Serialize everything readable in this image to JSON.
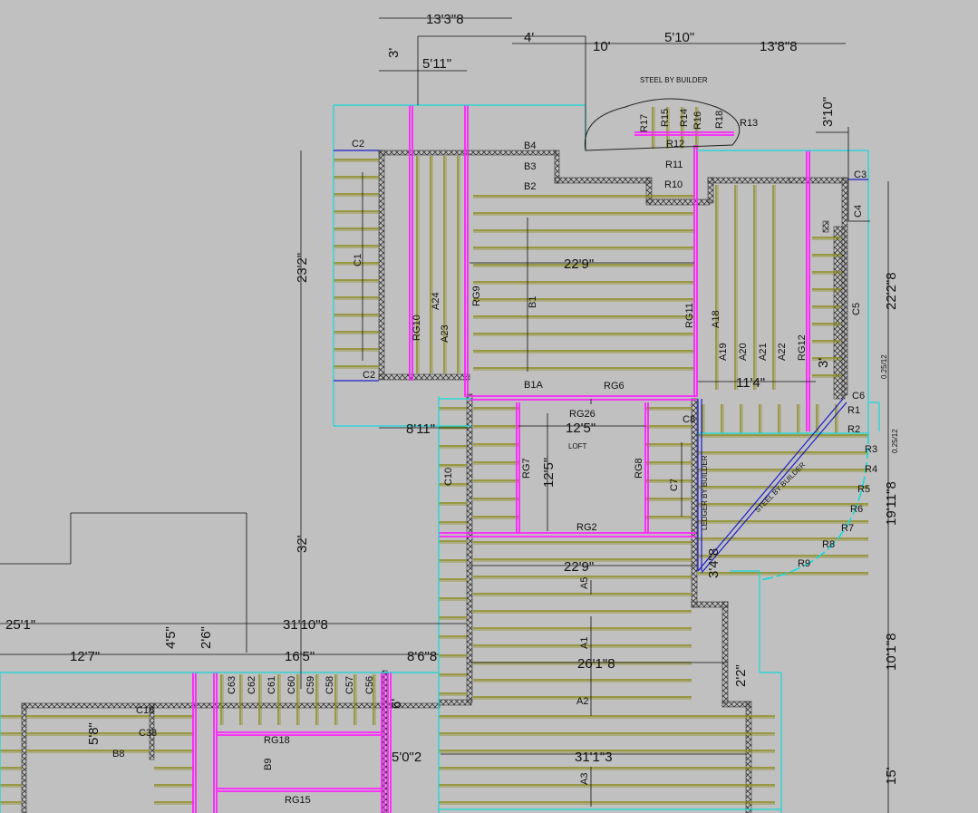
{
  "colors": {
    "background": "#c0c0c0",
    "joist": "#8a8a1a",
    "girder": "#ff22ff",
    "outline": "#14d8d8",
    "beam": "#1c1cc8",
    "dim": "#111111",
    "hatch": "#444444"
  },
  "dims": {
    "d_13_3_8": "13'3\"8",
    "d_4": "4'",
    "d_10": "10'",
    "d_5_10": "5'10\"",
    "d_13_8_8": "13'8\"8",
    "d_3": "3'",
    "d_5_11": "5'11\"",
    "d_3_10": "3'10\"",
    "d_23_2": "23'2\"",
    "d_22_9_top": "22'9\"",
    "d_22_2_8": "22'2\"8",
    "d_11_4": "11'4\"",
    "d_3b": "3'",
    "d_8_11": "8'11\"",
    "d_12_5_h": "12'5\"",
    "d_12_5_v": "12'5\"",
    "d_19_11_8": "19'11\"8",
    "d_32": "32'",
    "d_22_9_mid": "22'9\"",
    "d_3_4_8": "3'4\"8",
    "d_25_1": "25'1\"",
    "d_31_10_8": "31'10\"8",
    "d_4_5": "4'5\"",
    "d_2_6": "2'6\"",
    "d_12_7": "12'7\"",
    "d_16_5": "16'5\"",
    "d_8_6_8": "8'6\"8",
    "d_10_1_8": "10'1\"8",
    "d_26_1_8": "26'1\"8",
    "d_2_2": "2'2\"",
    "d_6": "6'",
    "d_5_0_2": "5'0\"2",
    "d_31_1_3": "31'1\"3",
    "d_5_8": "5'8\"",
    "d_15": "15'"
  },
  "slopes": {
    "s1": "0.25/12",
    "s2": "0.25/12"
  },
  "notes": {
    "steel_top": "STEEL BY BUILDER",
    "steel_diag": "STEEL BY BUILDER",
    "ledger": "LEDGER BY BUILDER",
    "loft": "LOFT"
  },
  "labels": {
    "B4": "B4",
    "B3": "B3",
    "B2": "B2",
    "B1": "B1",
    "B1A": "B1A",
    "C1": "C1",
    "C2a": "C2",
    "C2b": "C2",
    "C3": "C3",
    "C4": "C4",
    "C5": "C5",
    "C6": "C6",
    "C7": "C7",
    "C8": "C8",
    "C10": "C10",
    "A24": "A24",
    "A23": "A23",
    "A18": "A18",
    "A19": "A19",
    "A20": "A20",
    "A21": "A21",
    "A22": "A22",
    "RG9": "RG9",
    "RG10": "RG10",
    "RG11": "RG11",
    "RG12": "RG12",
    "RG6": "RG6",
    "RG26": "RG26",
    "RG7": "RG7",
    "RG8": "RG8",
    "RG2": "RG2",
    "R1": "R1",
    "R2": "R2",
    "R3": "R3",
    "R4": "R4",
    "R5": "R5",
    "R6": "R6",
    "R7": "R7",
    "R8": "R8",
    "R9": "R9",
    "R10": "R10",
    "R11": "R11",
    "R12": "R12",
    "R13": "R13",
    "R14": "R14",
    "R15": "R15",
    "R16": "R16",
    "R17": "R17",
    "R18": "R18",
    "A5": "A5",
    "A1": "A1",
    "A2": "A2",
    "A3": "A3",
    "RG18": "RG18",
    "RG15": "RG15",
    "B8": "B8",
    "B9": "B9",
    "C18": "C18",
    "C38": "C38",
    "C63": "C63",
    "C62": "C62",
    "C61": "C61",
    "C60": "C60",
    "C59": "C59",
    "C58": "C58",
    "C57": "C57",
    "C56": "C56"
  }
}
